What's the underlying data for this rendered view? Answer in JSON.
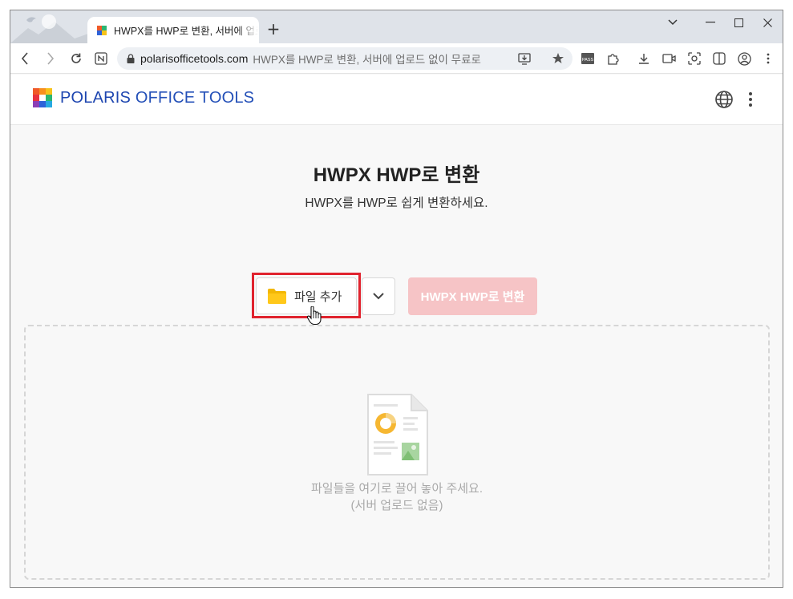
{
  "browser": {
    "tab_title": "HWPX를 HWP로 변환, 서버에 업로드 없이 무료로",
    "new_tab_label": "+",
    "url_host": "polarisofficetools.com",
    "url_rest": "HWPX를 HWP로 변환, 서버에 업로드 없이 무료로"
  },
  "site": {
    "logo_bold": "POLARIS",
    "logo_rest": " OFFICE TOOLS",
    "brand_color": "#2450b8"
  },
  "main": {
    "title": "HWPX HWP로 변환",
    "subtitle": "HWPX를 HWP로 쉽게 변환하세요.",
    "add_file_label": "파일 추가",
    "convert_label": "HWPX HWP로 변환",
    "drop_line1": "파일들을 여기로 끌어 놓아 주세요.",
    "drop_line2": "(서버 업로드 없음)"
  },
  "colors": {
    "highlight": "#e0232e",
    "convert_disabled": "#f6c4c6"
  }
}
